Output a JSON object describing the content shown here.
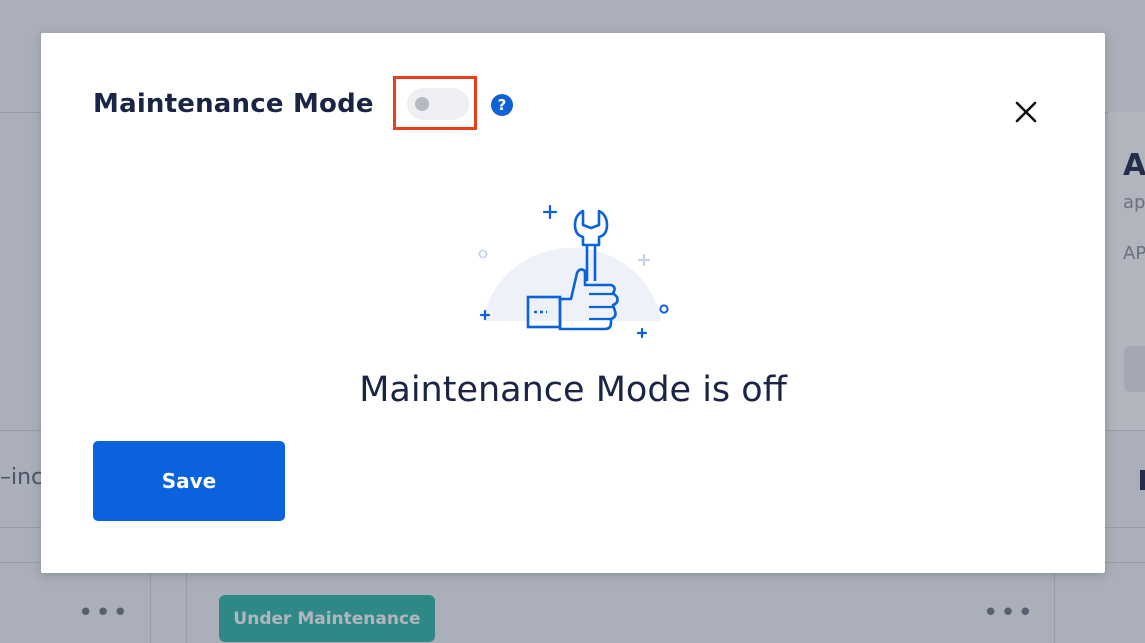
{
  "background": {
    "right_card_title": "A",
    "right_card_subtitle": "ap",
    "right_card_line": "AP",
    "left_row_text": "–inc",
    "row_menu_dots": "•••",
    "status_badge": "Under Maintenance"
  },
  "modal": {
    "title": "Maintenance Mode",
    "toggle": {
      "enabled": false
    },
    "help_icon_glyph": "?",
    "close_icon": "close-icon",
    "illustration_icon": "wrench-thumbs-up-icon",
    "status_text": "Maintenance Mode is off",
    "save_label": "Save"
  },
  "colors": {
    "primary": "#0a63dc",
    "title_text": "#1a2545",
    "highlight": "#e8401c",
    "badge": "#2bb6a6"
  }
}
